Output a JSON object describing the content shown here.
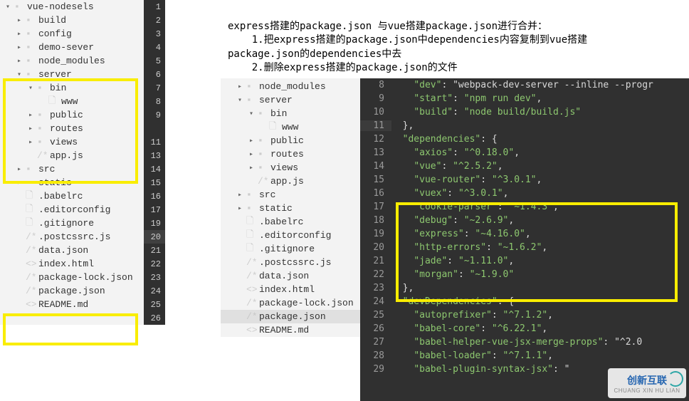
{
  "instructions": {
    "line1": "express搭建的package.json 与vue搭建package.json进行合并：",
    "line2": "    1.把express搭建的package.json中dependencies内容复制到vue搭建",
    "line3": "package.json的dependencies中去",
    "line4": "    2.删除express搭建的package.json的文件"
  },
  "tree1": {
    "root": "vue-nodesels",
    "items": [
      {
        "lvl": 0,
        "chev": "▾",
        "ico": "folder",
        "label": "vue-nodesels",
        "ln": 1
      },
      {
        "lvl": 1,
        "chev": "▸",
        "ico": "folder",
        "label": "build",
        "ln": 2
      },
      {
        "lvl": 1,
        "chev": "▸",
        "ico": "folder",
        "label": "config",
        "ln": 3
      },
      {
        "lvl": 1,
        "chev": "▸",
        "ico": "folder",
        "label": "demo-sever",
        "ln": 4
      },
      {
        "lvl": 1,
        "chev": "▸",
        "ico": "folder",
        "label": "node_modules",
        "ln": 5
      },
      {
        "lvl": 1,
        "chev": "▾",
        "ico": "folder-open",
        "label": "server",
        "ln": 6
      },
      {
        "lvl": 2,
        "chev": "▾",
        "ico": "folder-open",
        "label": "bin",
        "ln": 7
      },
      {
        "lvl": 3,
        "chev": "",
        "ico": "file",
        "label": "www",
        "ln": 8
      },
      {
        "lvl": 2,
        "chev": "▸",
        "ico": "folder",
        "label": "public",
        "ln": 9
      },
      {
        "lvl": 2,
        "chev": "▸",
        "ico": "folder",
        "label": "routes",
        "ln": ""
      },
      {
        "lvl": 2,
        "chev": "▸",
        "ico": "folder",
        "label": "views",
        "ln": 11
      },
      {
        "lvl": 2,
        "chev": "",
        "ico": "js",
        "label": "app.js",
        "ln": 13
      },
      {
        "lvl": 1,
        "chev": "▸",
        "ico": "folder",
        "label": "src",
        "ln": 14
      },
      {
        "lvl": 1,
        "chev": "▸",
        "ico": "folder",
        "label": "static",
        "ln": 15
      },
      {
        "lvl": 1,
        "chev": "",
        "ico": "file",
        "label": ".babelrc",
        "ln": 16
      },
      {
        "lvl": 1,
        "chev": "",
        "ico": "file",
        "label": ".editorconfig",
        "ln": 17
      },
      {
        "lvl": 1,
        "chev": "",
        "ico": "file",
        "label": ".gitignore",
        "ln": 19
      },
      {
        "lvl": 1,
        "chev": "",
        "ico": "js",
        "label": ".postcssrc.js",
        "ln": 20
      },
      {
        "lvl": 1,
        "chev": "",
        "ico": "js",
        "label": "data.json",
        "ln": 21
      },
      {
        "lvl": 1,
        "chev": "",
        "ico": "code",
        "label": "index.html",
        "ln": 22
      },
      {
        "lvl": 1,
        "chev": "",
        "ico": "js",
        "label": "package-lock.json",
        "ln": 23
      },
      {
        "lvl": 1,
        "chev": "",
        "ico": "js",
        "label": "package.json",
        "ln": 24
      },
      {
        "lvl": 1,
        "chev": "",
        "ico": "code",
        "label": "README.md",
        "ln": 25
      },
      {
        "lvl": 1,
        "chev": "",
        "ico": "",
        "label": "",
        "ln": 26
      }
    ]
  },
  "tree2": {
    "items": [
      {
        "lvl": 1,
        "chev": "▸",
        "ico": "folder",
        "label": "node_modules"
      },
      {
        "lvl": 1,
        "chev": "▾",
        "ico": "folder-open",
        "label": "server"
      },
      {
        "lvl": 2,
        "chev": "▾",
        "ico": "folder-open",
        "label": "bin"
      },
      {
        "lvl": 3,
        "chev": "",
        "ico": "file",
        "label": "www"
      },
      {
        "lvl": 2,
        "chev": "▸",
        "ico": "folder",
        "label": "public"
      },
      {
        "lvl": 2,
        "chev": "▸",
        "ico": "folder",
        "label": "routes"
      },
      {
        "lvl": 2,
        "chev": "▸",
        "ico": "folder",
        "label": "views"
      },
      {
        "lvl": 2,
        "chev": "",
        "ico": "js",
        "label": "app.js"
      },
      {
        "lvl": 1,
        "chev": "▸",
        "ico": "folder",
        "label": "src"
      },
      {
        "lvl": 1,
        "chev": "▸",
        "ico": "folder",
        "label": "static"
      },
      {
        "lvl": 1,
        "chev": "",
        "ico": "file",
        "label": ".babelrc"
      },
      {
        "lvl": 1,
        "chev": "",
        "ico": "file",
        "label": ".editorconfig"
      },
      {
        "lvl": 1,
        "chev": "",
        "ico": "file",
        "label": ".gitignore"
      },
      {
        "lvl": 1,
        "chev": "",
        "ico": "js",
        "label": ".postcssrc.js"
      },
      {
        "lvl": 1,
        "chev": "",
        "ico": "js",
        "label": "data.json"
      },
      {
        "lvl": 1,
        "chev": "",
        "ico": "code",
        "label": "index.html"
      },
      {
        "lvl": 1,
        "chev": "",
        "ico": "js",
        "label": "package-lock.json"
      },
      {
        "lvl": 1,
        "chev": "",
        "ico": "js",
        "label": "package.json",
        "sel": true
      },
      {
        "lvl": 1,
        "chev": "",
        "ico": "code",
        "label": "README.md"
      }
    ]
  },
  "editor": {
    "lines": [
      {
        "n": 8,
        "text": "    \"dev\": \"webpack-dev-server --inline --progr"
      },
      {
        "n": 9,
        "text": "    \"start\": \"npm run dev\","
      },
      {
        "n": 10,
        "text": "    \"build\": \"node build/build.js\""
      },
      {
        "n": 11,
        "text": "  },",
        "hl": true
      },
      {
        "n": 12,
        "text": "  \"dependencies\": {"
      },
      {
        "n": 13,
        "text": "    \"axios\": \"^0.18.0\","
      },
      {
        "n": 14,
        "text": "    \"vue\": \"^2.5.2\","
      },
      {
        "n": 15,
        "text": "    \"vue-router\": \"^3.0.1\","
      },
      {
        "n": 16,
        "text": "    \"vuex\": \"^3.0.1\","
      },
      {
        "n": 17,
        "text": "    \"cookie-parser\": \"~1.4.3\","
      },
      {
        "n": 18,
        "text": "    \"debug\": \"~2.6.9\","
      },
      {
        "n": 19,
        "text": "    \"express\": \"~4.16.0\","
      },
      {
        "n": 20,
        "text": "    \"http-errors\": \"~1.6.2\","
      },
      {
        "n": 21,
        "text": "    \"jade\": \"~1.11.0\","
      },
      {
        "n": 22,
        "text": "    \"morgan\": \"~1.9.0\""
      },
      {
        "n": 23,
        "text": "  },"
      },
      {
        "n": 24,
        "text": "  \"devDependencies\": {"
      },
      {
        "n": 25,
        "text": "    \"autoprefixer\": \"^7.1.2\","
      },
      {
        "n": 26,
        "text": "    \"babel-core\": \"^6.22.1\","
      },
      {
        "n": 27,
        "text": "    \"babel-helper-vue-jsx-merge-props\": \"^2.0"
      },
      {
        "n": 28,
        "text": "    \"babel-loader\": \"^7.1.1\","
      },
      {
        "n": 29,
        "text": "    \"babel-plugin-syntax-jsx\": \""
      }
    ]
  },
  "icons": {
    "folder": "📁",
    "folder-open": "📂",
    "file": "🗋",
    "js": "/* ",
    "code": "<>"
  },
  "logo": {
    "text": "创新互联",
    "sub": "CHUANG XIN HU LIAN"
  }
}
